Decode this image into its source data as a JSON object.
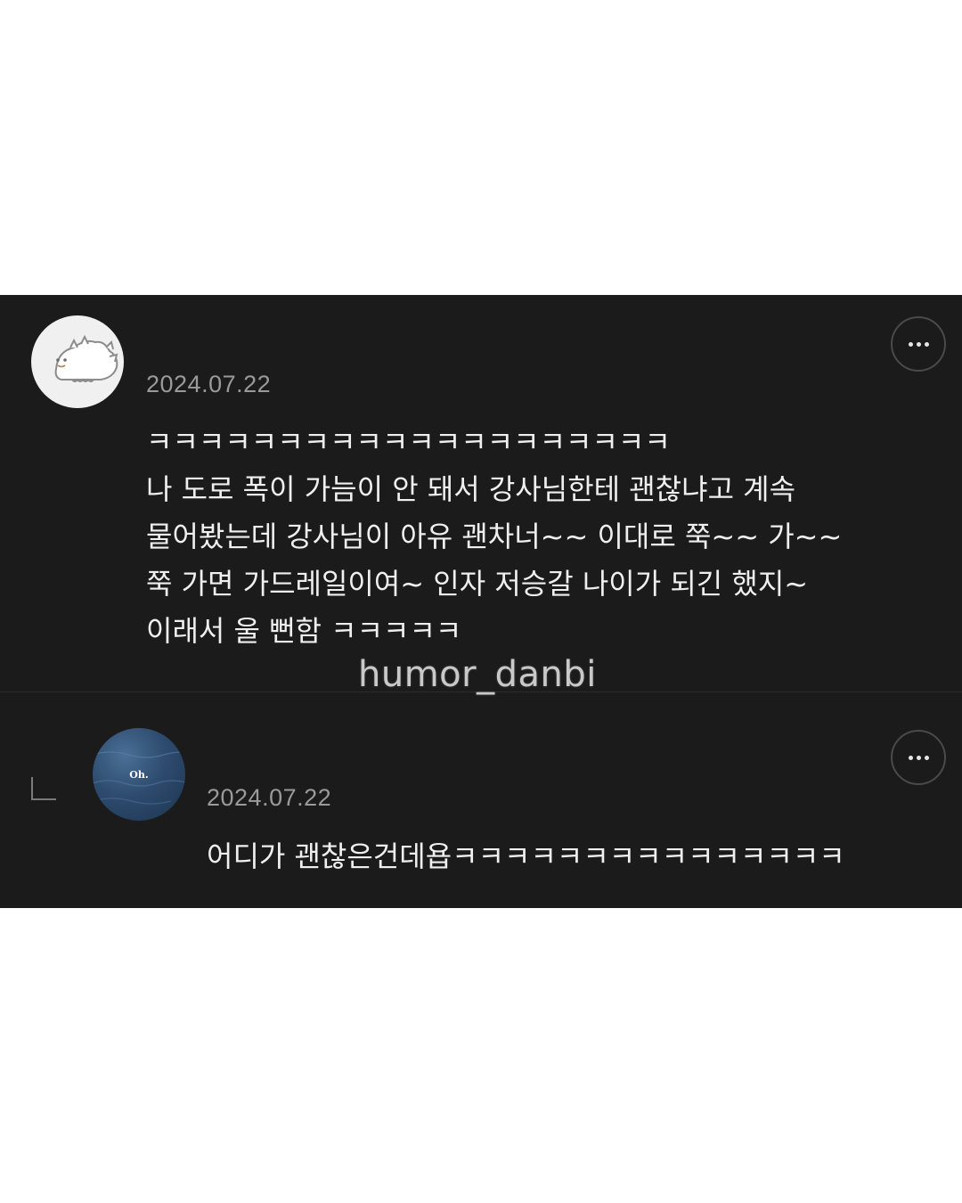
{
  "comments": [
    {
      "date": "2024.07.22",
      "text": "ㅋㅋㅋㅋㅋㅋㅋㅋㅋㅋㅋㅋㅋㅋㅋㅋㅋㅋㅋㅋ\n나 도로 폭이 가늠이 안 돼서 강사님한테 괜찮냐고 계속\n물어봤는데 강사님이 아유 괜차너~~ 이대로 쭉~~ 가~~\n쭉 가면 가드레일이여~ 인자 저승갈 나이가 되긴 했지~\n이래서 울 뻔함 ㅋㅋㅋㅋㅋ",
      "avatar_icon": "dinosaur-avatar-icon",
      "more_icon": "more-options-icon"
    },
    {
      "date": "2024.07.22",
      "text": "어디가 괜찮은건데욥ㅋㅋㅋㅋㅋㅋㅋㅋㅋㅋㅋㅋㅋㅋㅋ",
      "avatar_label": "Oh.",
      "avatar_icon": "ocean-avatar-icon",
      "more_icon": "more-options-icon",
      "reply_icon": "reply-indicator-icon"
    }
  ],
  "watermark": "humor_danbi",
  "colors": {
    "panel_bg": "#1b1b1b",
    "text": "#efefef",
    "date": "#9a9a9a"
  }
}
